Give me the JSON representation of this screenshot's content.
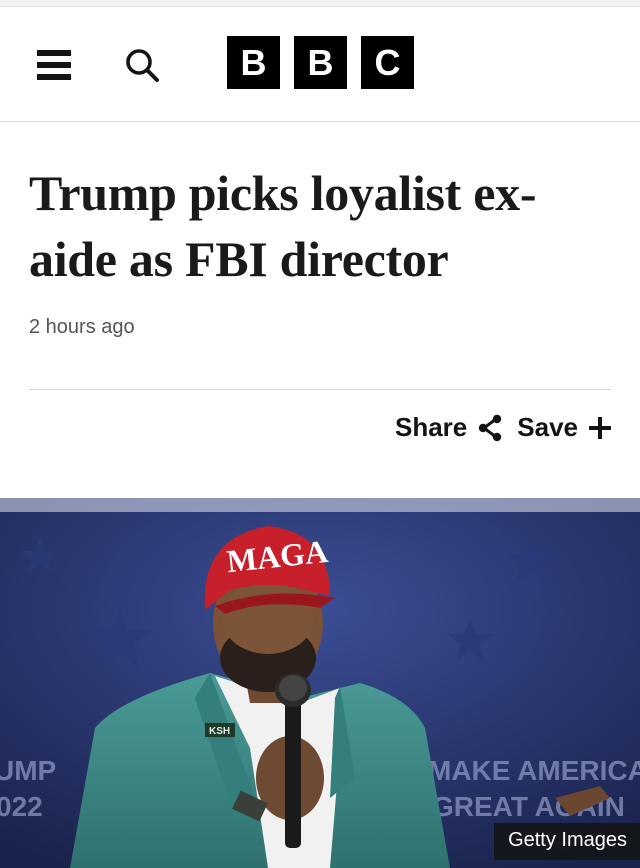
{
  "header": {
    "menu_icon": "hamburger-menu-icon",
    "search_icon": "search-icon",
    "logo_letters": [
      "B",
      "B",
      "C"
    ]
  },
  "article": {
    "headline": "Trump picks loyalist ex-aide as FBI director",
    "timestamp": "2 hours ago",
    "share_label": "Share",
    "share_icon": "share-icon",
    "save_label": "Save",
    "save_icon": "plus-icon"
  },
  "hero_image": {
    "cap_text": "MAGA",
    "pin_text": "KSH",
    "bg_text_left": [
      "UMP",
      "022"
    ],
    "bg_text_right": [
      "MAKE AMERICA",
      "GREAT AGAIN"
    ],
    "credit": "Getty Images"
  },
  "colors": {
    "cap_red": "#c8202a",
    "jacket_teal": "#3f8f8c",
    "background_blue": "#2b3b78"
  }
}
